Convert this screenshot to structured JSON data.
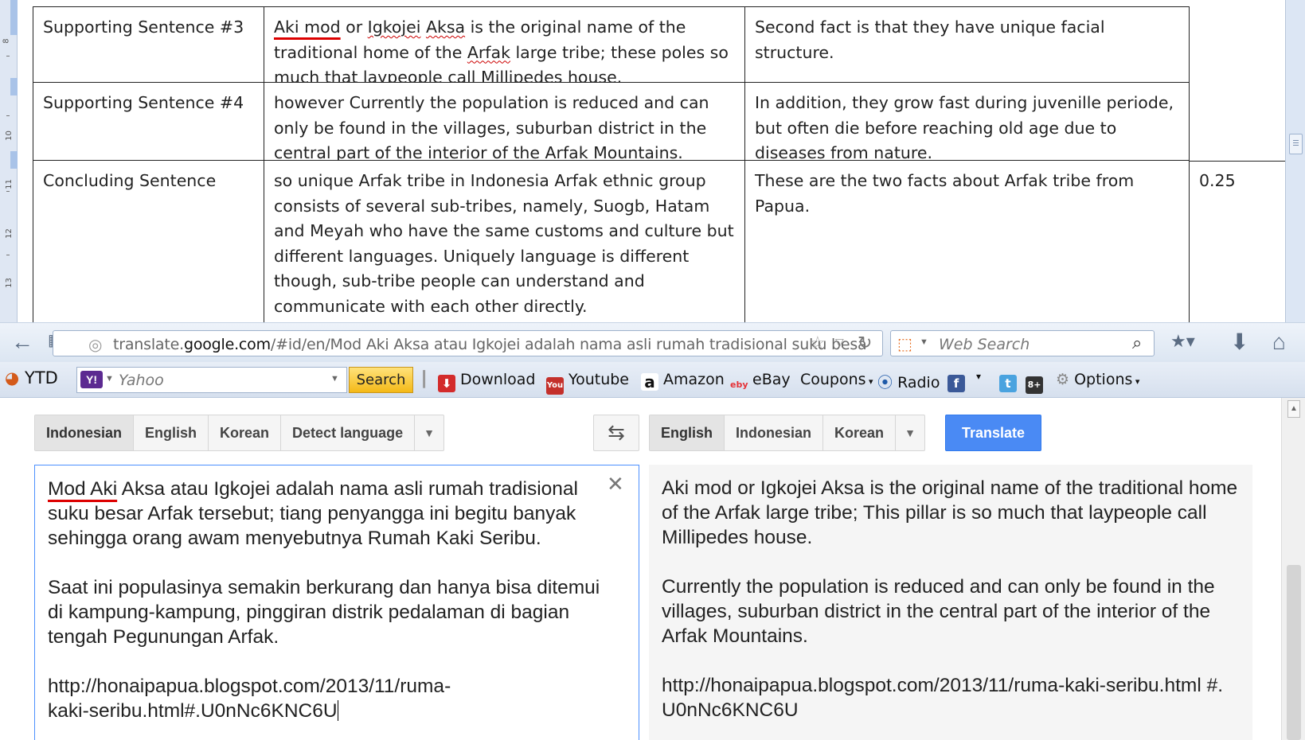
{
  "doc": {
    "ruler_numbers": [
      "8",
      "10",
      "11",
      "12",
      "13"
    ],
    "rows": [
      {
        "label": "Supporting Sentence #3",
        "text_html": "<span class=\"redline\">Aki mod</span> or <span class=\"sq\">Igkojei</span> <span class=\"sq\">Aksa</span> is the original name of the traditional home of the <span class=\"sq\">Arfak</span> large tribe; these poles so much that laypeople call Millipedes house.",
        "text": "Aki mod or Igkojei Aksa is the original name of the traditional home of the Arfak large tribe; these poles so much that laypeople call Millipedes house.",
        "feedback": "Second fact is that they have unique facial structure.",
        "score": ""
      },
      {
        "label": "Supporting Sentence #4",
        "text": "however Currently the population  is reduced and can only be found  in the villages, suburban district in the central part of the interior of the Arfak Mountains.",
        "feedback": "In addition, they grow fast during juvenille periode, but often die before reaching old age due to diseases from nature.",
        "score": ""
      },
      {
        "label": "Concluding Sentence",
        "text": "so unique  Arfak tribe in Indonesia  Arfak ethnic group consists of several sub-tribes,  namely, Suogb,  Hatam and Meyah who have the same customs and culture but different languages. Uniquely language is different though, sub-tribe people can understand and communicate with each other directly.",
        "feedback": "These are the two facts about  Arfak tribe from Papua.",
        "score": "0.25"
      }
    ]
  },
  "browser": {
    "url_prefix": "translate.",
    "url_domain": "google.com",
    "url_rest": "/#id/en/Mod Aki Aksa atau Igkojei adalah nama asli rumah tradisional suku besa",
    "search_placeholder": "Web Search",
    "bookmarks": {
      "ytd": "YTD",
      "yahoo_placeholder": "Yahoo",
      "search_btn": "Search",
      "download": "Download",
      "youtube": "Youtube",
      "amazon": "Amazon",
      "ebay": "eBay",
      "coupons": "Coupons",
      "radio": "Radio",
      "options": "Options"
    }
  },
  "translate": {
    "source_langs": [
      "Indonesian",
      "English",
      "Korean",
      "Detect language"
    ],
    "target_langs": [
      "English",
      "Indonesian",
      "Korean"
    ],
    "translate_btn": "Translate",
    "source_first": "Mod Aki",
    "source_text": " Aksa atau Igkojei adalah nama asli rumah tradisional suku besar Arfak tersebut; tiang penyangga ini begitu banyak sehingga orang awam menyebutnya Rumah Kaki Seribu.\n\nSaat ini populasinya semakin berkurang dan hanya bisa ditemui di kampung-kampung, pinggiran distrik pedalaman di bagian tengah Pegunungan Arfak.\n\nhttp://honaipapua.blogspot.com/2013/11/ruma-\nkaki-seribu.html#.U0nNc6KNC6U",
    "result_text": "Aki mod or Igkojei Aksa is the original name of the traditional home of the Arfak large tribe; This pillar is so much that laypeople call Millipedes house.\n\nCurrently the population is reduced and can only be found in the villages, suburban district in the central part of the interior of the Arfak Mountains.\n\nhttp://honaipapua.blogspot.com/2013/11/ruma-kaki-seribu.html #.\nU0nNc6KNC6U"
  }
}
